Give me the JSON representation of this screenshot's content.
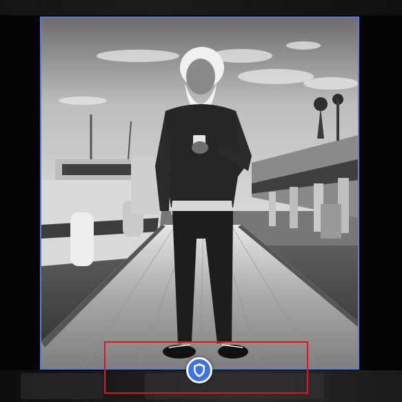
{
  "photo": {
    "description_icon": "portrait-photo",
    "grayscale": true
  },
  "overlay": {
    "badge_icon": "shield-icon",
    "badge_color": "#3d73e8",
    "frame_color": "#5b7fe0",
    "selection_color": "#e0141b"
  }
}
